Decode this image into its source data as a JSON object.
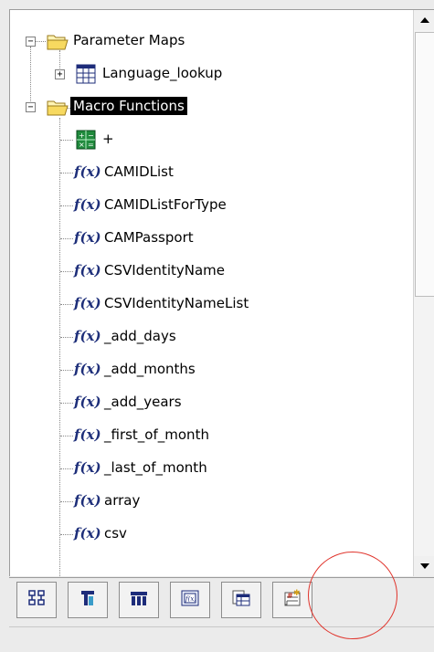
{
  "tree": {
    "parameter_maps": {
      "label": "Parameter Maps",
      "expander": "−",
      "icon": "folder-open-icon"
    },
    "language_lookup": {
      "label": "Language_lookup",
      "expander": "+",
      "icon": "table-icon"
    },
    "macro_functions": {
      "label": "Macro Functions",
      "expander": "−",
      "icon": "folder-open-icon",
      "selected": true
    },
    "operator_plus": {
      "label": "+",
      "icon": "calculator-icon"
    },
    "fx_glyph": "f(x)",
    "functions": [
      "CAMIDList",
      "CAMIDListForType",
      "CAMPassport",
      "CSVIdentityName",
      "CSVIdentityNameList",
      "_add_days",
      "_add_months",
      "_add_years",
      "_first_of_month",
      "_last_of_month",
      "array",
      "csv"
    ]
  },
  "toolbar": {
    "buttons": [
      {
        "name": "hierarchy-tab-button",
        "icon": "hierarchy-icon"
      },
      {
        "name": "data-source-tab-button",
        "icon": "data-source-icon"
      },
      {
        "name": "data-items-tab-button",
        "icon": "columns-icon"
      },
      {
        "name": "functions-tab-button",
        "icon": "function-icon"
      },
      {
        "name": "parameter-maps-tab-button",
        "icon": "parameter-map-icon"
      },
      {
        "name": "macros-tab-button",
        "icon": "macro-icon",
        "highlighted": true
      }
    ]
  },
  "colors": {
    "selection_bg": "#000000",
    "selection_text": "#ffffff",
    "fx_color": "#1e2f7a",
    "folder": "#f7d960",
    "highlight_ring": "#e0342c"
  }
}
